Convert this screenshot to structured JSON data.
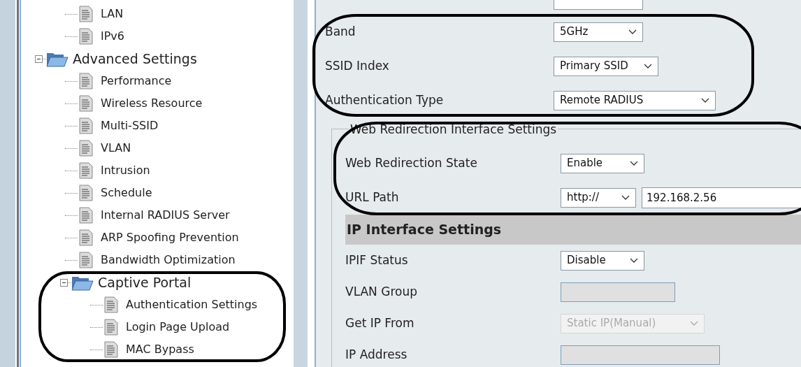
{
  "tree": [
    {
      "kind": "tail",
      "children": [
        {
          "kind": "page",
          "label": "LAN"
        },
        {
          "kind": "page",
          "label": "IPv6"
        }
      ]
    },
    {
      "kind": "folder",
      "label": "Advanced Settings",
      "expanded": true,
      "children": [
        {
          "kind": "page",
          "label": "Performance"
        },
        {
          "kind": "page",
          "label": "Wireless Resource"
        },
        {
          "kind": "page",
          "label": "Multi-SSID"
        },
        {
          "kind": "page",
          "label": "VLAN"
        },
        {
          "kind": "page",
          "label": "Intrusion"
        },
        {
          "kind": "page",
          "label": "Schedule"
        },
        {
          "kind": "page",
          "label": "Internal RADIUS Server"
        },
        {
          "kind": "page",
          "label": "ARP Spoofing Prevention"
        },
        {
          "kind": "page",
          "label": "Bandwidth Optimization"
        },
        {
          "kind": "folder",
          "label": "Captive Portal",
          "expanded": true,
          "children": [
            {
              "kind": "page",
              "label": "Authentication Settings"
            },
            {
              "kind": "page",
              "label": "Login Page Upload"
            },
            {
              "kind": "page",
              "label": "MAC Bypass"
            }
          ]
        }
      ]
    }
  ],
  "form": {
    "fields": [
      {
        "kind": "select",
        "label": "Band",
        "value": "5GHz",
        "disabled": false
      },
      {
        "kind": "select",
        "label": "SSID Index",
        "value": "Primary SSID",
        "disabled": false
      },
      {
        "kind": "select",
        "label": "Authentication Type",
        "value": "Remote RADIUS",
        "disabled": false
      }
    ],
    "web_redirection": {
      "legend": "Web Redirection Interface Settings",
      "fields": [
        {
          "kind": "select",
          "label": "Web Redirection State",
          "value": "Enable",
          "disabled": false
        },
        {
          "kind": "url",
          "label": "URL Path",
          "scheme": "http://",
          "value": "192.168.2.56",
          "disabled": false
        }
      ]
    },
    "ip_interface": {
      "title": "IP Interface Settings",
      "fields": [
        {
          "kind": "select",
          "label": "IPIF Status",
          "value": "Disable",
          "disabled": false
        },
        {
          "kind": "text",
          "label": "VLAN Group",
          "disabled": true
        },
        {
          "kind": "select",
          "label": "Get IP From",
          "value": "Static IP(Manual)",
          "disabled": true
        },
        {
          "kind": "text",
          "label": "IP Address",
          "disabled": true
        }
      ]
    }
  }
}
